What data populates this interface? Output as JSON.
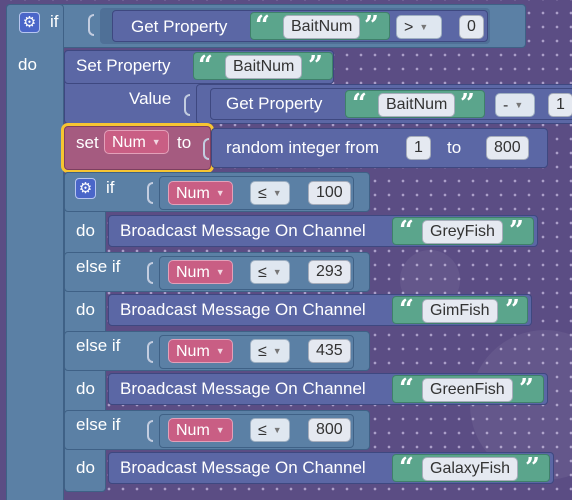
{
  "outer_if": {
    "if_label": "if",
    "do_label": "do",
    "condition": {
      "get_property_label": "Get Property",
      "property_name": "BaitNum",
      "operator": ">",
      "value": "0"
    }
  },
  "set_property": {
    "label": "Set Property",
    "property_name": "BaitNum",
    "value_label": "Value",
    "get_property_label": "Get Property",
    "get_property_name": "BaitNum",
    "math_operator": "-",
    "math_value": "1"
  },
  "set_var": {
    "set_label": "set",
    "var_name": "Num",
    "to_label": "to",
    "random_label": "random integer from",
    "from_value": "1",
    "to_word": "to",
    "to_value": "800"
  },
  "inner_if": {
    "if_label": "if",
    "branches": [
      {
        "cond_label": "if",
        "var": "Num",
        "operator": "≤",
        "value": "100",
        "do_label": "do",
        "action": "Broadcast Message On Channel",
        "channel": "GreyFish"
      },
      {
        "cond_label": "else if",
        "var": "Num",
        "operator": "≤",
        "value": "293",
        "do_label": "do",
        "action": "Broadcast Message On Channel",
        "channel": "GimFish"
      },
      {
        "cond_label": "else if",
        "var": "Num",
        "operator": "≤",
        "value": "435",
        "do_label": "do",
        "action": "Broadcast Message On Channel",
        "channel": "GreenFish"
      },
      {
        "cond_label": "else if",
        "var": "Num",
        "operator": "≤",
        "value": "800",
        "do_label": "do",
        "action": "Broadcast Message On Channel",
        "channel": "GalaxyFish"
      }
    ]
  },
  "colors": {
    "control": "#5b80a5",
    "action": "#5b67a5",
    "variable": "#a55b80",
    "string": "#5ba58c",
    "workspace": "#5b4d84",
    "selection": "#f7c531"
  },
  "icons": {
    "mutator": "gear-icon",
    "open_quote": "open-quote-icon",
    "close_quote": "close-quote-icon",
    "dropdown": "dropdown-caret-icon"
  }
}
